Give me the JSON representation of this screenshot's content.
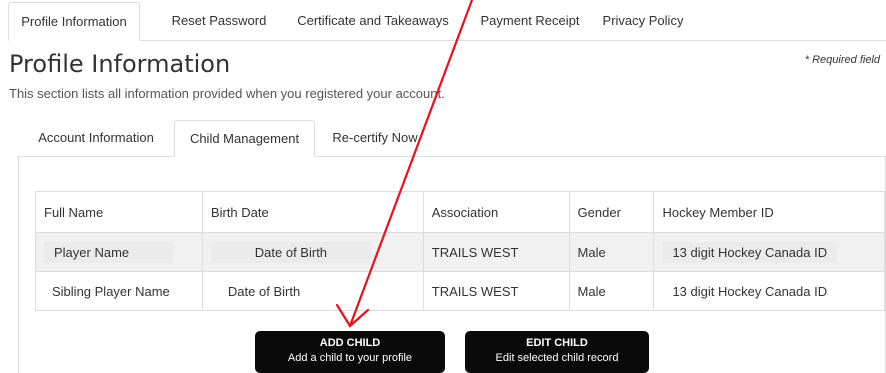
{
  "top_tabs": [
    {
      "label": "Profile Information",
      "active": true
    },
    {
      "label": "Reset Password",
      "active": false
    },
    {
      "label": "Certificate and Takeaways",
      "active": false
    },
    {
      "label": "Payment Receipt",
      "active": false
    },
    {
      "label": "Privacy Policy",
      "active": false
    }
  ],
  "page": {
    "title": "Profile Information",
    "required_note": "* Required field",
    "description": "This section lists all information provided when you registered your account."
  },
  "sub_tabs": [
    {
      "label": "Account Information",
      "active": false
    },
    {
      "label": "Child Management",
      "active": true
    },
    {
      "label": "Re-certify Now",
      "active": false
    }
  ],
  "table": {
    "columns": [
      "Full Name",
      "Birth Date",
      "Association",
      "Gender",
      "Hockey Member ID"
    ],
    "rows": [
      {
        "name": "Player Name",
        "birth_date": "Date of Birth",
        "association": "TRAILS WEST",
        "gender": "Male",
        "member_id": "13 digit Hockey Canada ID"
      },
      {
        "name": "Sibling Player Name",
        "birth_date": "Date of Birth",
        "association": "TRAILS WEST",
        "gender": "Male",
        "member_id": "13 digit Hockey Canada ID"
      }
    ]
  },
  "buttons": {
    "add_child": {
      "title": "ADD CHILD",
      "subtitle": "Add a child to your profile"
    },
    "edit_child": {
      "title": "EDIT CHILD",
      "subtitle": "Edit selected child record"
    }
  },
  "annotation": {
    "color": "#e8101a"
  }
}
